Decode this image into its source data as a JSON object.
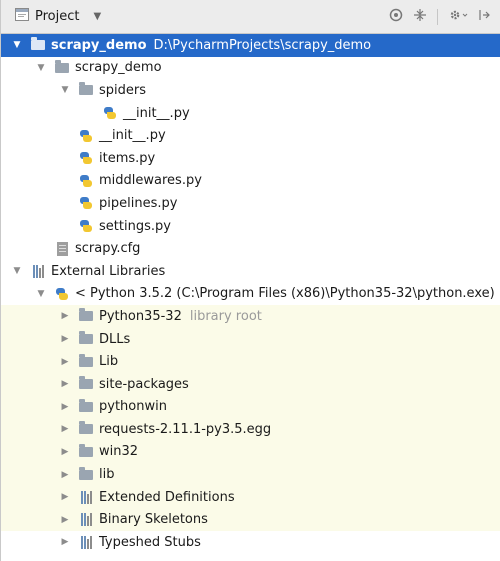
{
  "header": {
    "title": "Project",
    "dropdown_glyph": "▼",
    "icons": [
      "target-icon",
      "collapse-icon",
      "settings-icon",
      "hide-icon"
    ]
  },
  "tree": {
    "root": {
      "name": "scrapy_demo",
      "path": "D:\\PycharmProjects\\scrapy_demo"
    },
    "pkg": {
      "name": "scrapy_demo"
    },
    "spiders": {
      "name": "spiders"
    },
    "spiders_init": {
      "name": "__init__.py"
    },
    "init": {
      "name": "__init__.py"
    },
    "items": {
      "name": "items.py"
    },
    "middlewares": {
      "name": "middlewares.py"
    },
    "pipelines": {
      "name": "pipelines.py"
    },
    "settings": {
      "name": "settings.py"
    },
    "cfg": {
      "name": "scrapy.cfg"
    },
    "ext_libs": {
      "name": "External Libraries"
    },
    "python": {
      "name": "< Python 3.5.2 (C:\\Program Files (x86)\\Python35-32\\python.exe) >"
    },
    "lib_items": [
      {
        "name": "Python35-32",
        "tag": "library root",
        "kind": "folder"
      },
      {
        "name": "DLLs",
        "tag": "",
        "kind": "folder"
      },
      {
        "name": "Lib",
        "tag": "",
        "kind": "folder"
      },
      {
        "name": "site-packages",
        "tag": "",
        "kind": "folder"
      },
      {
        "name": "pythonwin",
        "tag": "",
        "kind": "folder"
      },
      {
        "name": "requests-2.11.1-py3.5.egg",
        "tag": "",
        "kind": "folder"
      },
      {
        "name": "win32",
        "tag": "",
        "kind": "folder"
      },
      {
        "name": "lib",
        "tag": "",
        "kind": "folder"
      },
      {
        "name": "Extended Definitions",
        "tag": "",
        "kind": "libs"
      },
      {
        "name": "Binary Skeletons",
        "tag": "",
        "kind": "libs"
      },
      {
        "name": "Typeshed Stubs",
        "tag": "",
        "kind": "libs"
      }
    ]
  },
  "colors": {
    "selection": "#2569c9",
    "library_background": "#fbfbe8",
    "library_root_tag": "#9a9a9a"
  }
}
